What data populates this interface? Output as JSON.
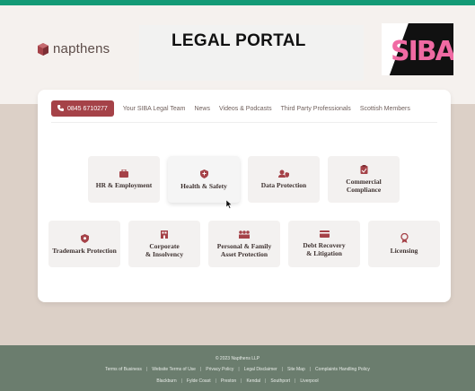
{
  "header": {
    "brand": "napthens",
    "portal_title": "LEGAL PORTAL",
    "partner_logo": "SIBA"
  },
  "nav": {
    "phone": "0845 6710277",
    "items": [
      "Your SIBA Legal Team",
      "News",
      "Videos & Podcasts",
      "Third Party Professionals",
      "Scottish Members"
    ]
  },
  "tiles": [
    {
      "label": "HR & Employment",
      "icon": "briefcase-icon"
    },
    {
      "label": "Health & Safety",
      "icon": "shield-plus-icon"
    },
    {
      "label": "Data Protection",
      "icon": "user-shield-icon"
    },
    {
      "label": "Commercial\nCompliance",
      "icon": "clipboard-check-icon"
    },
    {
      "label": "Trademark Protection",
      "icon": "shield-icon"
    },
    {
      "label": "Corporate\n& Insolvency",
      "icon": "building-icon"
    },
    {
      "label": "Personal & Family\nAsset Protection",
      "icon": "people-icon"
    },
    {
      "label": "Debt Recovery\n& Litigation",
      "icon": "credit-card-icon"
    },
    {
      "label": "Licensing",
      "icon": "award-icon"
    }
  ],
  "footer": {
    "copyright": "© 2023 Napthens LLP",
    "links": [
      "Terms of Business",
      "Website Terms of Use",
      "Privacy Policy",
      "Legal Disclaimer",
      "Site Map",
      "Complaints Handling Policy"
    ],
    "places": [
      "Blackburn",
      "Fylde Coast",
      "Preston",
      "Kendal",
      "Southport",
      "Liverpool"
    ]
  },
  "colors": {
    "accent": "#a54248",
    "top_strip": "#149a76",
    "footer_bg": "#6b7d6e",
    "siba_pink": "#f06aa3"
  }
}
